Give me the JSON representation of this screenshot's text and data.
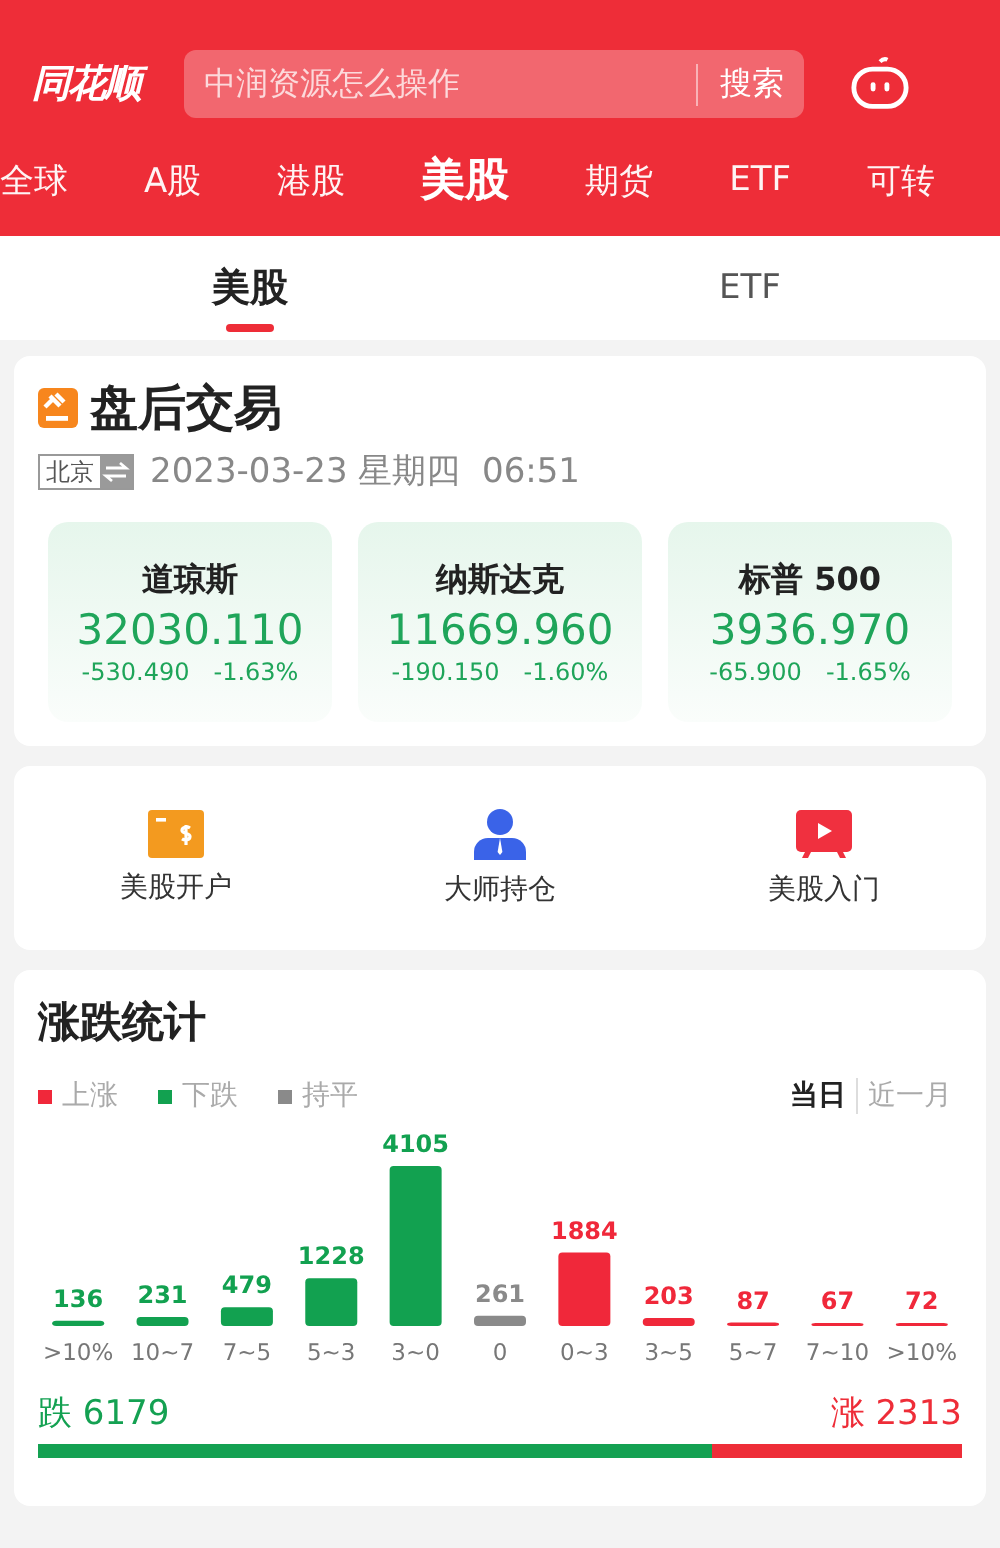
{
  "header": {
    "logo": "同花顺",
    "search": {
      "placeholder": "中润资源怎么操作",
      "button": "搜索"
    }
  },
  "market_tabs": [
    {
      "label": "全球",
      "selected": false
    },
    {
      "label": "A股",
      "selected": false
    },
    {
      "label": "港股",
      "selected": false
    },
    {
      "label": "美股",
      "selected": true
    },
    {
      "label": "期货",
      "selected": false
    },
    {
      "label": "ETF",
      "selected": false
    },
    {
      "label": "可转",
      "selected": false
    }
  ],
  "sub_tabs": [
    {
      "label": "美股",
      "selected": true
    },
    {
      "label": "ETF",
      "selected": false
    }
  ],
  "session": {
    "title": "盘后交易",
    "timezone": "北京",
    "datetime": "2023-03-23 星期四  06:51"
  },
  "indices": [
    {
      "name": "道琼斯",
      "value": "32030.110",
      "change": "-530.490",
      "percent": "-1.63%"
    },
    {
      "name": "纳斯达克",
      "value": "11669.960",
      "change": "-190.150",
      "percent": "-1.60%"
    },
    {
      "name": "标普 500",
      "value": "3936.970",
      "change": "-65.900",
      "percent": "-1.65%"
    }
  ],
  "shortcuts": [
    {
      "label": "美股开户",
      "kind": "account"
    },
    {
      "label": "大师持仓",
      "kind": "master"
    },
    {
      "label": "美股入门",
      "kind": "video"
    }
  ],
  "stats": {
    "title": "涨跌统计",
    "periods": [
      {
        "label": "当日",
        "selected": true
      },
      {
        "label": "近一月",
        "selected": false
      }
    ],
    "legend": [
      {
        "label": "上涨",
        "color": "#f0283a"
      },
      {
        "label": "下跌",
        "color": "#12a150"
      },
      {
        "label": "持平",
        "color": "#8a8a8a"
      }
    ],
    "bars": [
      {
        "color": "#12a150"
      },
      {
        "color": "#12a150"
      },
      {
        "color": "#12a150"
      },
      {
        "color": "#12a150"
      },
      {
        "color": "#12a150"
      },
      {
        "color": "#8a8a8a"
      },
      {
        "color": "#f0283a"
      },
      {
        "color": "#f0283a"
      },
      {
        "color": "#f0283a"
      },
      {
        "color": "#f0283a"
      },
      {
        "color": "#f0283a"
      }
    ],
    "chart_data": {
      "type": "bar",
      "data_labels": true,
      "categories": [
        ">10%",
        "10~7",
        "7~5",
        "5~3",
        "3~0",
        "0",
        "0~3",
        "3~5",
        "5~7",
        "7~10",
        ">10%"
      ],
      "values": [
        136,
        231,
        479,
        1228,
        4105,
        261,
        1884,
        203,
        87,
        67,
        72
      ]
    },
    "falls": "跌 6179",
    "rises": "涨 2313",
    "level": 0.73
  }
}
